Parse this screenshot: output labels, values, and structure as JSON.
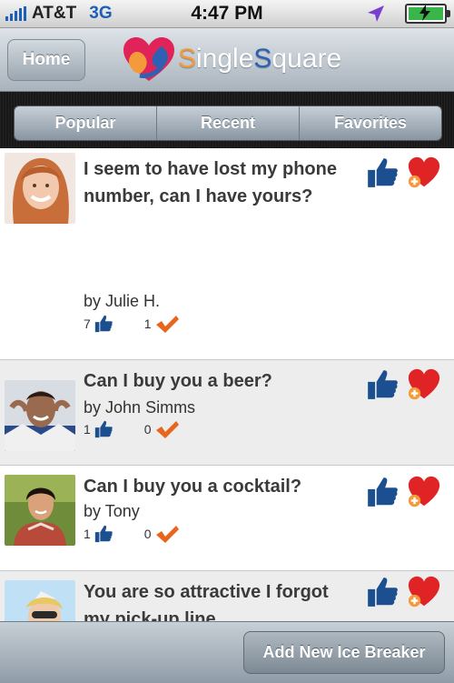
{
  "status_bar": {
    "carrier": "AT&T",
    "network": "3G",
    "time": "4:47 PM"
  },
  "nav": {
    "home_label": "Home",
    "logo_text_part1": "S",
    "logo_text_part2": "ingle",
    "logo_text_part3": "S",
    "logo_text_part4": "quare"
  },
  "tabs": [
    {
      "label": "Popular"
    },
    {
      "label": "Recent"
    },
    {
      "label": "Favorites"
    }
  ],
  "items": [
    {
      "title": "I seem to have lost my phone number, can I have yours?",
      "by": "by",
      "author": "Julie H.",
      "likes": "7",
      "checks": "1"
    },
    {
      "title": "Can I buy you a beer?",
      "by": "by",
      "author": "John Simms",
      "likes": "1",
      "checks": "0"
    },
    {
      "title": "Can I buy you a cocktail?",
      "by": "by",
      "author": "Tony",
      "likes": "1",
      "checks": "0"
    },
    {
      "title": "You are so attractive I forgot my pick-up line"
    }
  ],
  "toolbar": {
    "add_label": "Add New Ice Breaker"
  },
  "colors": {
    "thumb_blue": "#1c4f8f",
    "heart_red": "#e02426",
    "check_orange": "#e8651c"
  }
}
